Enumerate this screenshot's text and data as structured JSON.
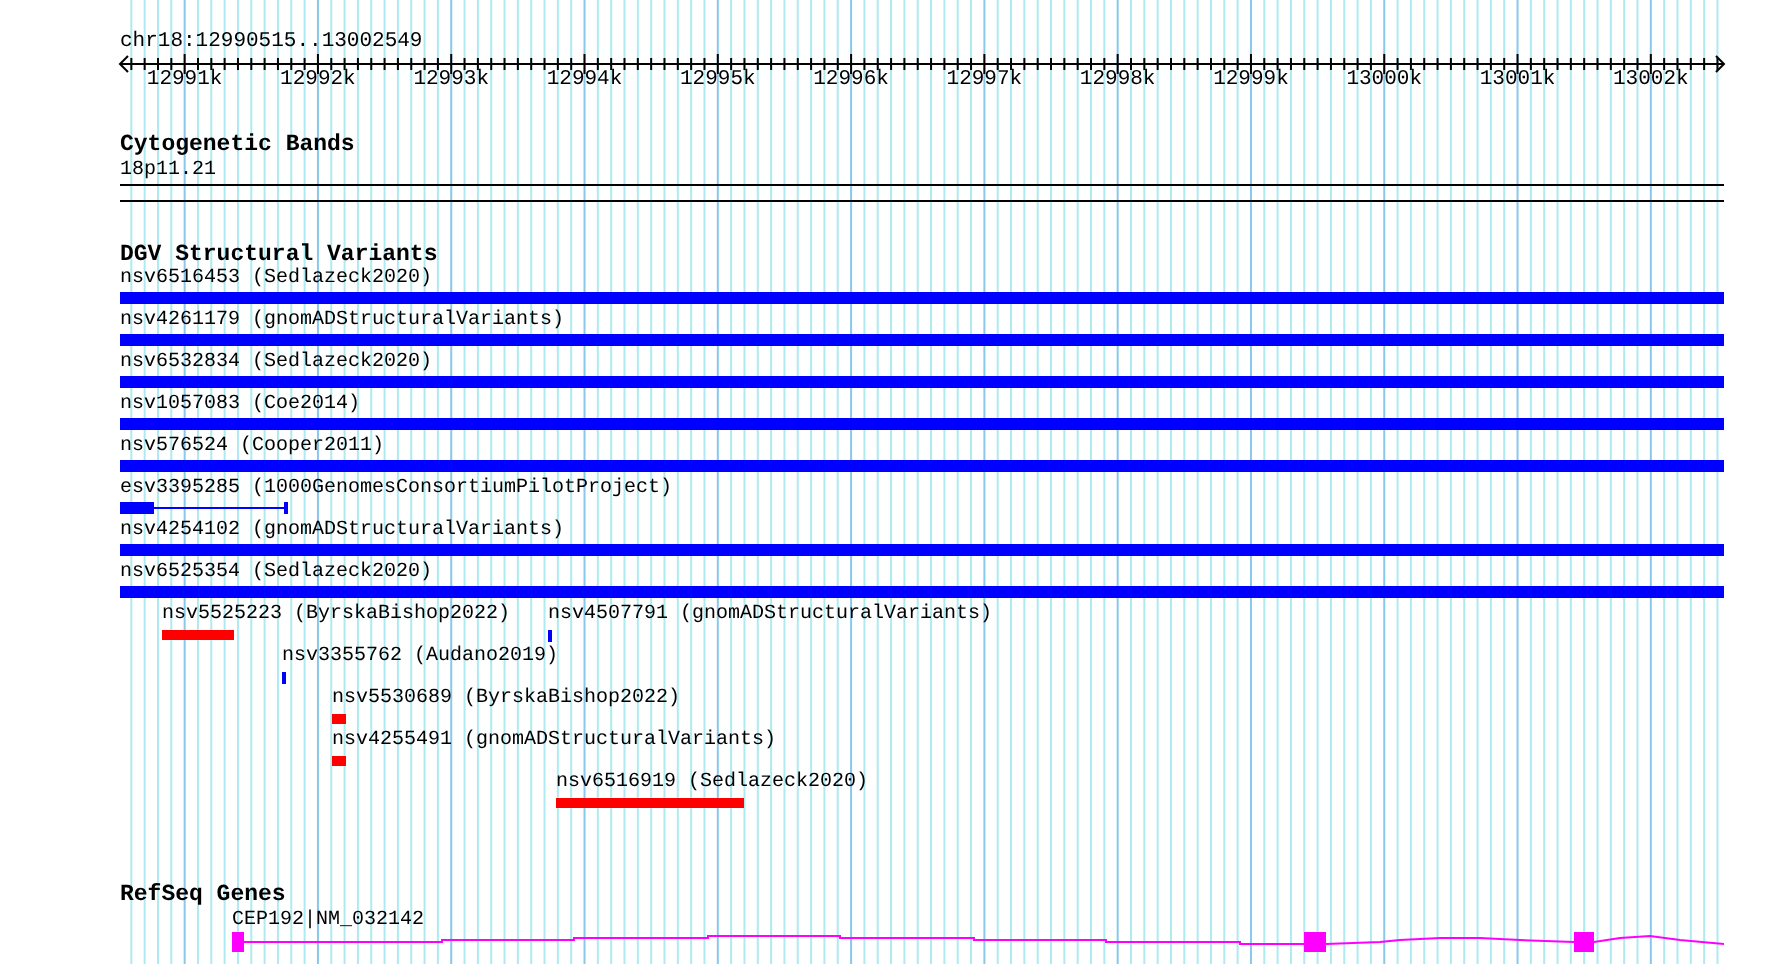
{
  "ruler": {
    "location": "chr18:12990515..13002549",
    "tick_labels": [
      "12991k",
      "12992k",
      "12993k",
      "12994k",
      "12995k",
      "12996k",
      "12997k",
      "12998k",
      "12999k",
      "13000k",
      "13001k",
      "13002k"
    ]
  },
  "cytogenetic_bands": {
    "title": "Cytogenetic Bands",
    "band": "18p11.21"
  },
  "dgv_structural_variants": {
    "title": "DGV Structural Variants",
    "features": [
      {
        "label": "nsv6516453 (Sedlazeck2020)",
        "color": "#0000ff",
        "kind": "bar"
      },
      {
        "label": "nsv4261179 (gnomADStructuralVariants)",
        "color": "#0000ff",
        "kind": "bar"
      },
      {
        "label": "nsv6532834 (Sedlazeck2020)",
        "color": "#0000ff",
        "kind": "bar"
      },
      {
        "label": "nsv1057083 (Coe2014)",
        "color": "#0000ff",
        "kind": "bar"
      },
      {
        "label": "nsv576524 (Cooper2011)",
        "color": "#0000ff",
        "kind": "bar"
      },
      {
        "label": "esv3395285 (1000GenomesConsortiumPilotProject)",
        "color": "#0000ff",
        "kind": "gapped"
      },
      {
        "label": "nsv4254102 (gnomADStructuralVariants)",
        "color": "#0000ff",
        "kind": "bar"
      },
      {
        "label": "nsv6525354 (Sedlazeck2020)",
        "color": "#0000ff",
        "kind": "bar"
      },
      {
        "label": "nsv5525223 (ByrskaBishop2022)",
        "color": "#ff0000",
        "kind": "bar"
      },
      {
        "label": "nsv4507791 (gnomADStructuralVariants)",
        "color": "#0000ff",
        "kind": "bar"
      },
      {
        "label": "nsv3355762 (Audano2019)",
        "color": "#0000ff",
        "kind": "bar"
      },
      {
        "label": "nsv5530689 (ByrskaBishop2022)",
        "color": "#ff0000",
        "kind": "bar"
      },
      {
        "label": "nsv4255491 (gnomADStructuralVariants)",
        "color": "#ff0000",
        "kind": "bar"
      },
      {
        "label": "nsv6516919 (Sedlazeck2020)",
        "color": "#ff0000",
        "kind": "bar"
      }
    ]
  },
  "refseq_genes": {
    "title": "RefSeq Genes",
    "genes": [
      {
        "label": "CEP192|NM_032142"
      }
    ]
  }
}
